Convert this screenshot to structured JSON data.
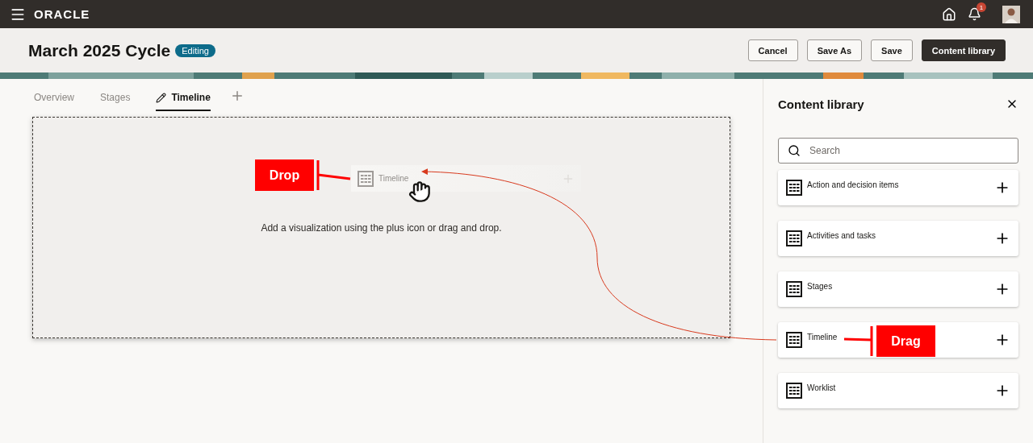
{
  "top_bar": {
    "logo": "ORACLE",
    "notification_count": "1"
  },
  "header": {
    "title": "March 2025 Cycle",
    "status_badge": "Editing",
    "buttons": [
      {
        "label": "Cancel",
        "kind": "secondary"
      },
      {
        "label": "Save As",
        "kind": "secondary"
      },
      {
        "label": "Save",
        "kind": "secondary"
      },
      {
        "label": "Content library",
        "kind": "primary"
      }
    ]
  },
  "tabs": [
    {
      "label": "Overview",
      "selected": false,
      "editing": false
    },
    {
      "label": "Stages",
      "selected": false,
      "editing": false
    },
    {
      "label": "Timeline",
      "selected": true,
      "editing": true
    }
  ],
  "canvas": {
    "drag_preview": {
      "label": "Timeline"
    },
    "drop_callout": "Drop",
    "hint": "Add a visualization using the plus icon or drag and drop."
  },
  "content_library": {
    "title": "Content library",
    "search": {
      "placeholder": "Search"
    },
    "items": [
      {
        "label": "Action and decision items"
      },
      {
        "label": "Activities and tasks"
      },
      {
        "label": "Stages"
      },
      {
        "label": "Timeline",
        "callout": "Drag"
      },
      {
        "label": "Worklist"
      }
    ]
  }
}
